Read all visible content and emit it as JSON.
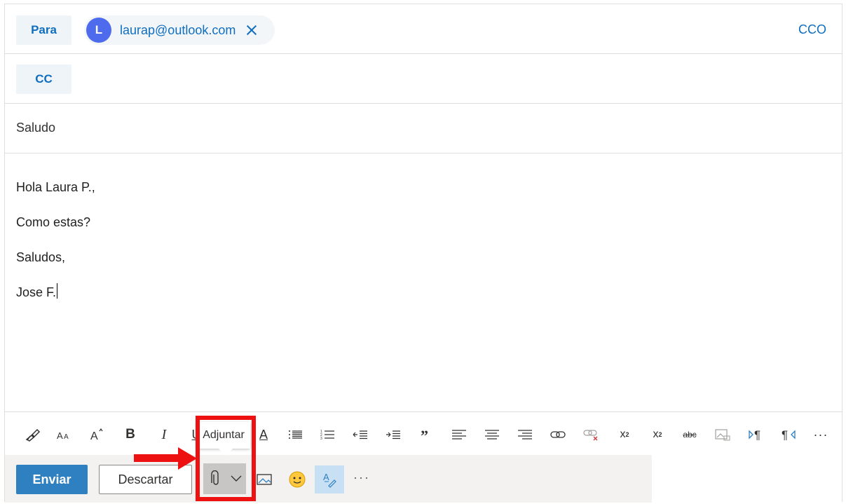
{
  "to": {
    "label": "Para",
    "recipient_initial": "L",
    "recipient_email": "laurap@outlook.com",
    "bcc_label": "CCO"
  },
  "cc": {
    "label": "CC"
  },
  "subject": {
    "value": "Saludo"
  },
  "body": {
    "lines": [
      "Hola Laura P.,",
      "Como estas?",
      "Saludos,",
      "Jose F."
    ]
  },
  "format_toolbar": {
    "icons": [
      "format-painter-icon",
      "font-size-icon",
      "grow-font-icon",
      "bold-icon",
      "italic-icon",
      "underline-icon",
      "font-color-icon",
      "bullets-icon",
      "numbering-icon",
      "decrease-indent-icon",
      "increase-indent-icon",
      "quote-icon",
      "align-left-icon",
      "align-center-icon",
      "align-right-icon",
      "insert-link-icon",
      "remove-link-icon",
      "superscript-icon",
      "subscript-icon",
      "strikethrough-icon",
      "insert-picture-disabled-icon",
      "ltr-icon",
      "rtl-icon",
      "more-options-icon"
    ],
    "bold": "B",
    "italic": "I",
    "underline": "U",
    "font_color": "A",
    "superscript_base": "x",
    "superscript_exp": "2",
    "subscript_base": "x",
    "subscript_exp": "2",
    "strike": "abc",
    "more": "···"
  },
  "actions": {
    "send_label": "Enviar",
    "discard_label": "Descartar",
    "more": "···"
  },
  "tooltip": {
    "text": "Adjuntar"
  },
  "colors": {
    "accent": "#106ebe",
    "send": "#2f80c0",
    "avatar": "#4f6bed",
    "highlight": "#ee1111"
  }
}
